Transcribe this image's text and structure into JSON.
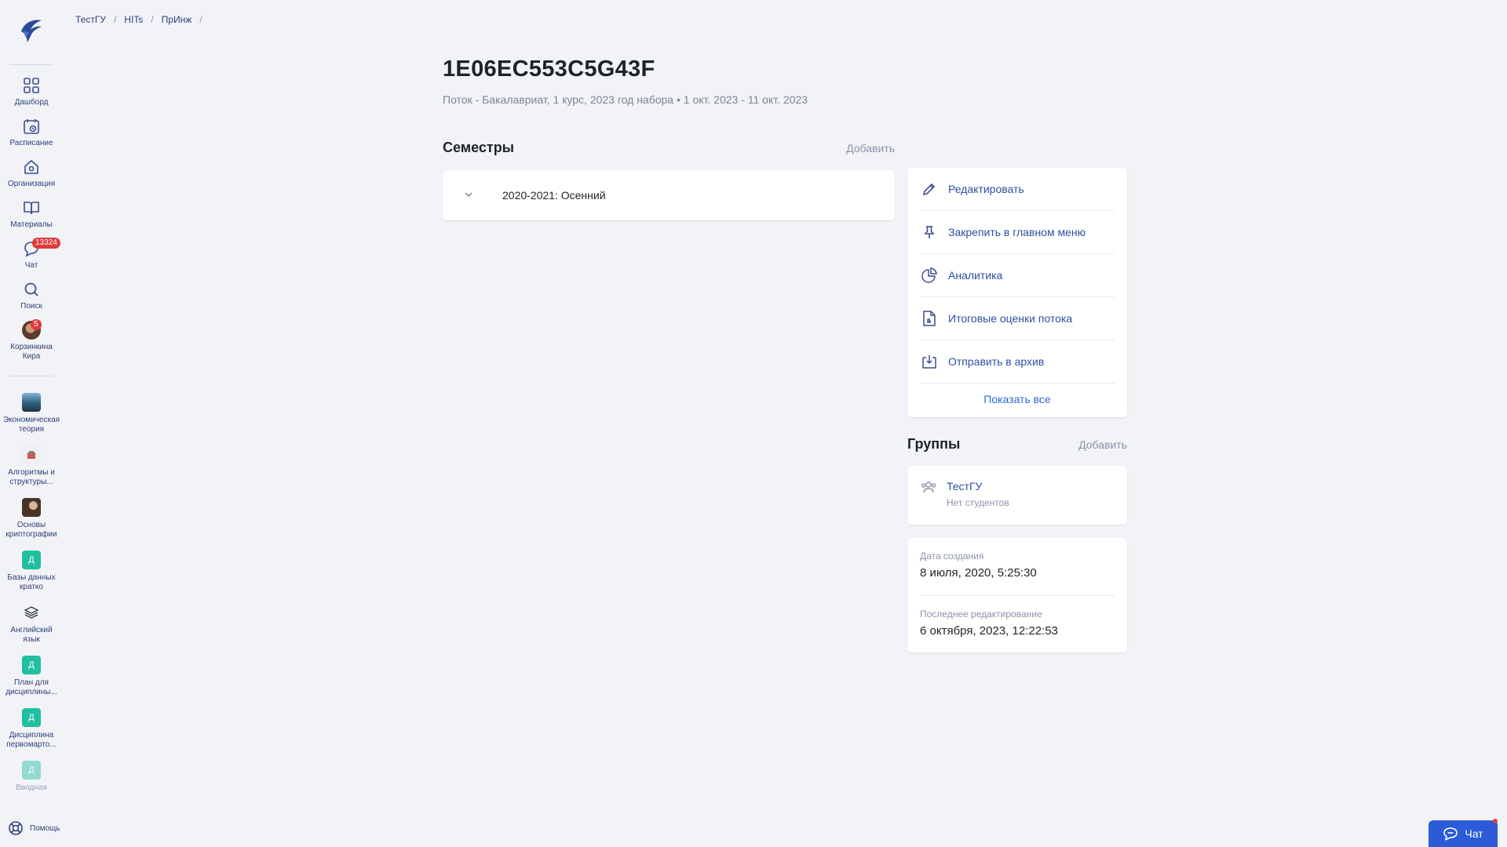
{
  "breadcrumb": [
    "ТестГУ",
    "HITs",
    "ПрИнж"
  ],
  "sidebar": {
    "nav": [
      {
        "label": "Дашборд",
        "icon": "dashboard-icon"
      },
      {
        "label": "Расписание",
        "icon": "calendar-icon"
      },
      {
        "label": "Организация",
        "icon": "organization-icon"
      },
      {
        "label": "Материалы",
        "icon": "book-icon"
      },
      {
        "label": "Чат",
        "icon": "chat-icon",
        "badge": "13324"
      },
      {
        "label": "Поиск",
        "icon": "search-icon"
      },
      {
        "label": "Корзинкина Кира",
        "icon": "avatar",
        "badge": "5"
      }
    ],
    "courses": [
      {
        "label": "Экономическая теория",
        "thumb": ""
      },
      {
        "label": "Алгоритмы и структуры...",
        "thumb": ""
      },
      {
        "label": "Основы криптографии",
        "thumb": ""
      },
      {
        "label": "Базы данных кратко",
        "thumb": "Д"
      },
      {
        "label": "Английский язык",
        "thumb": ""
      },
      {
        "label": "План для дисциплины...",
        "thumb": "Д"
      },
      {
        "label": "Дисциплина первомарто...",
        "thumb": "Д"
      },
      {
        "label": "Вводная",
        "thumb": "Д"
      }
    ],
    "help": "Помощь"
  },
  "header": {
    "title": "1E06EC553C5G43F",
    "subtitle": "Поток - Бакалавриат, 1 курс, 2023 год набора • 1 окт. 2023 - 11 окт. 2023"
  },
  "semesters": {
    "title": "Семестры",
    "add": "Добавить",
    "items": [
      "2020-2021: Осенний"
    ]
  },
  "actions": {
    "items": [
      {
        "label": "Редактировать",
        "icon": "pencil-icon"
      },
      {
        "label": "Закрепить в главном меню",
        "icon": "pin-icon"
      },
      {
        "label": "Аналитика",
        "icon": "pie-chart-icon"
      },
      {
        "label": "Итоговые оценки потока",
        "icon": "grade-document-icon"
      },
      {
        "label": "Отправить в архив",
        "icon": "archive-icon"
      }
    ],
    "show_all": "Показать все"
  },
  "groups": {
    "title": "Группы",
    "add": "Добавить",
    "items": [
      {
        "name": "ТестГУ",
        "sub": "Нет студентов"
      }
    ]
  },
  "meta": {
    "created_label": "Дата создания",
    "created_value": "8 июля, 2020, 5:25:30",
    "edited_label": "Последнее редактирование",
    "edited_value": "6 октября, 2023, 12:22:53"
  },
  "chat_button": "Чат",
  "colors": {
    "accent": "#2b5bd6",
    "badge": "#e33a3a",
    "teal": "#1fbf9f"
  }
}
